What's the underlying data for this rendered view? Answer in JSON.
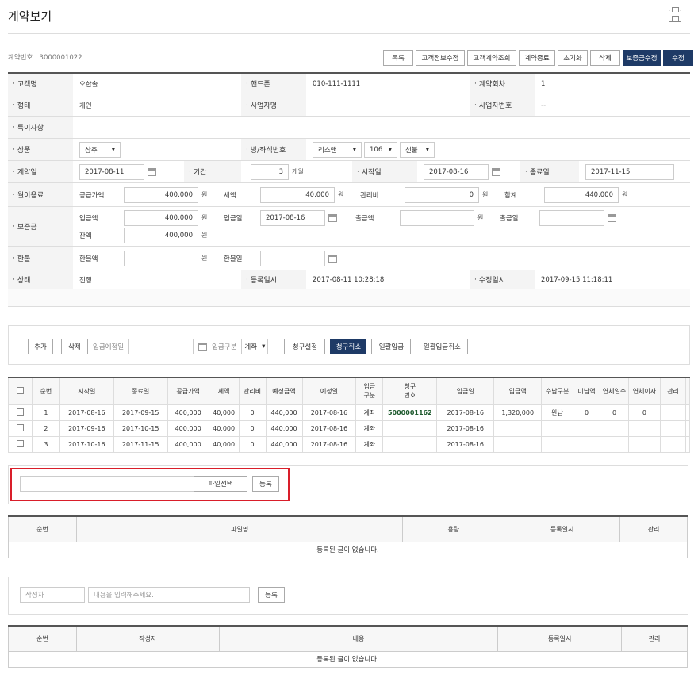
{
  "header": {
    "title": "계약보기",
    "contract_no": "계약번호 : 3000001022"
  },
  "topbtns": [
    "목록",
    "고객정보수정",
    "고객계약조회",
    "계약종료",
    "초기화",
    "삭제",
    "보증금수정",
    "수정"
  ],
  "info": {
    "customer_label": "고객명",
    "customer": "오한솔",
    "phone_label": "핸드폰",
    "phone": "010-111-1111",
    "times_label": "계약회차",
    "times": "1",
    "type_label": "형태",
    "type": "개인",
    "biz_label": "사업자명",
    "biz": "",
    "bizno_label": "사업자번호",
    "bizno": "--",
    "special_label": "특이사항",
    "product_label": "상품",
    "product": "상주",
    "room_label": "방/좌석번호",
    "room1": "리스맨",
    "room2": "106",
    "room3": "선불",
    "date_label": "계약일",
    "date": "2017-08-11",
    "period_label": "기간",
    "period": "3",
    "period_unit": "개월",
    "start_label": "시작일",
    "start": "2017-08-16",
    "end_label": "종료일",
    "end": "2017-11-15",
    "fee_label": "월이용료",
    "supply_label": "공급가액",
    "supply": "400,000",
    "tax_label": "세액",
    "tax": "40,000",
    "mgmt_label": "관리비",
    "mgmt": "0",
    "total_label": "합계",
    "total": "440,000",
    "won": "원",
    "dep_label": "보증금",
    "dep_in_label": "입금액",
    "dep_in": "400,000",
    "dep_date_label": "입금일",
    "dep_date": "2017-08-16",
    "dep_out_label": "출금액",
    "dep_outdate_label": "출금일",
    "dep_rem_label": "잔액",
    "dep_rem": "400,000",
    "refund_label": "환불",
    "refund_amt_label": "환불액",
    "refund_date_label": "환불일",
    "status_label": "상태",
    "status": "진행",
    "reg_label": "등록일시",
    "reg": "2017-08-11 10:28:18",
    "mod_label": "수정일시",
    "mod": "2017-09-15 11:18:11"
  },
  "billing": {
    "add": "추가",
    "del": "삭제",
    "due_label": "입금예정일",
    "kind_label": "입금구분",
    "kind": "계좌",
    "b1": "청구설정",
    "b2": "청구취소",
    "b3": "일괄입금",
    "b4": "일괄입금취소"
  },
  "grid": {
    "headers": [
      "순번",
      "시작일",
      "종료일",
      "공급가액",
      "세액",
      "관리비",
      "예정금액",
      "예정일",
      "입금\n구분",
      "청구\n번호",
      "입금일",
      "입금액",
      "수납구분",
      "미납액",
      "연체일수",
      "연체이자",
      "관리"
    ],
    "rows": [
      [
        "1",
        "2017-08-16",
        "2017-09-15",
        "400,000",
        "40,000",
        "0",
        "440,000",
        "2017-08-16",
        "계좌",
        "5000001162",
        "2017-08-16",
        "1,320,000",
        "완납",
        "0",
        "0",
        "0",
        ""
      ],
      [
        "2",
        "2017-09-16",
        "2017-10-15",
        "400,000",
        "40,000",
        "0",
        "440,000",
        "2017-08-16",
        "계좌",
        "",
        "2017-08-16",
        "",
        "",
        "",
        "",
        "",
        ""
      ],
      [
        "3",
        "2017-10-16",
        "2017-11-15",
        "400,000",
        "40,000",
        "0",
        "440,000",
        "2017-08-16",
        "계좌",
        "",
        "2017-08-16",
        "",
        "",
        "",
        "",
        "",
        ""
      ]
    ]
  },
  "file": {
    "choose": "파일선택",
    "register": "등록",
    "headers": [
      "순번",
      "파일명",
      "용량",
      "등록일시",
      "관리"
    ],
    "empty": "등록된 글이 없습니다."
  },
  "memo": {
    "writer_ph": "작성자",
    "content_ph": "내용을 입력해주세요.",
    "register": "등록",
    "headers": [
      "순번",
      "작성자",
      "내용",
      "등록일시",
      "관리"
    ],
    "empty": "등록된 글이 없습니다."
  }
}
